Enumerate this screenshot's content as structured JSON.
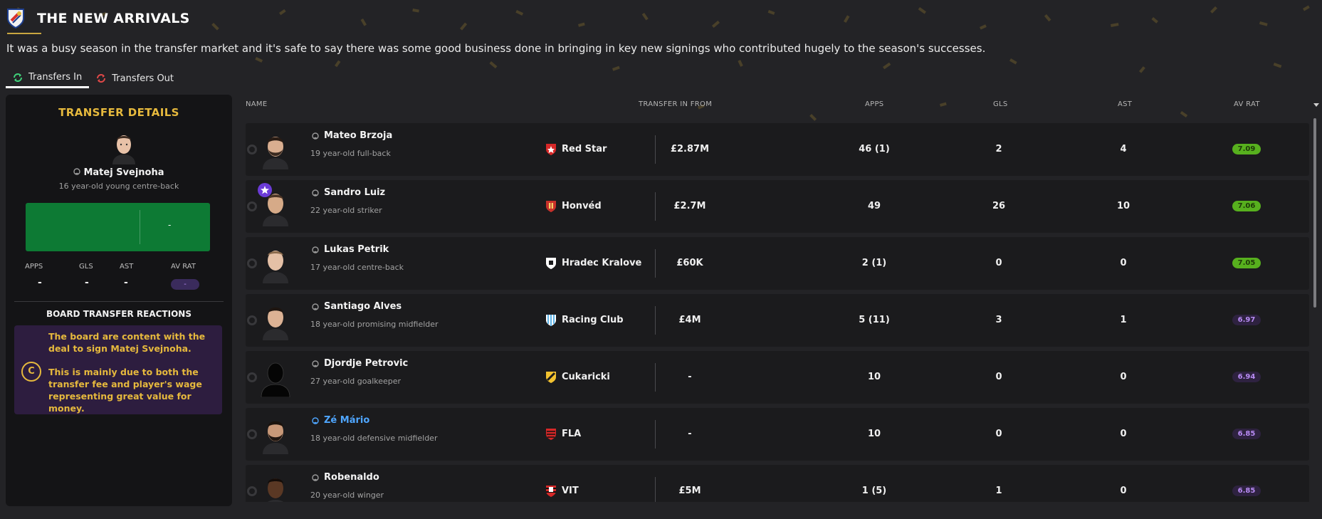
{
  "header": {
    "title": "THE NEW ARRIVALS",
    "subtitle": "It was a busy season in the transfer market and it's safe to say there was some good business done in bringing in key new signings who contributed hugely to the season's successes."
  },
  "tabs": [
    {
      "label": "Transfers In",
      "active": true
    },
    {
      "label": "Transfers Out",
      "active": false
    }
  ],
  "details": {
    "title": "TRANSFER DETAILS",
    "player_name": "Matej Svejnoha",
    "player_desc": "16 year-old young centre-back",
    "fee_value": "-",
    "stat_labels": {
      "apps": "APPS",
      "gls": "GLS",
      "ast": "AST",
      "avrat": "AV RAT"
    },
    "stat_values": {
      "apps": "-",
      "gls": "-",
      "ast": "-",
      "avrat": "-"
    },
    "board_title": "BOARD TRANSFER REACTIONS",
    "board_grade": "C",
    "board_text_1": "The board are content with the deal to sign Matej Svejnoha.",
    "board_text_2": "This is mainly due to both the transfer fee and player's wage representing great value for money."
  },
  "columns": {
    "name": "NAME",
    "from": "TRANSFER IN FROM",
    "apps": "APPS",
    "gls": "GLS",
    "ast": "AST",
    "avrat": "AV RAT"
  },
  "colors": {
    "accent_gold": "#e6b93d",
    "rating_green": "#57b01e",
    "rating_purple": "#b98cf5",
    "fee_box": "#0d7a34"
  },
  "rows": [
    {
      "name": "Mateo Brzoja",
      "desc": "19 year-old full-back",
      "club": "Red Star",
      "club_badge": "red-star-badge",
      "fee": "£2.87M",
      "apps": "46 (1)",
      "gls": "2",
      "ast": "4",
      "rating": "7.09",
      "rating_tier": "green",
      "star": false,
      "link": false,
      "face": "bearded-face"
    },
    {
      "name": "Sandro Luiz",
      "desc": "22 year-old striker",
      "club": "Honvéd",
      "club_badge": "honved-badge",
      "fee": "£2.7M",
      "apps": "49",
      "gls": "26",
      "ast": "10",
      "rating": "7.06",
      "rating_tier": "green",
      "star": true,
      "link": false,
      "face": "short-hair-face"
    },
    {
      "name": "Lukas Petrik",
      "desc": "17 year-old centre-back",
      "club": "Hradec Kralove",
      "club_badge": "hradec-kralove-badge",
      "fee": "£60K",
      "apps": "2 (1)",
      "gls": "0",
      "ast": "0",
      "rating": "7.05",
      "rating_tier": "green",
      "star": false,
      "link": false,
      "face": "young-face"
    },
    {
      "name": "Santiago Alves",
      "desc": "18 year-old promising midfielder",
      "club": "Racing Club",
      "club_badge": "racing-club-badge",
      "fee": "£4M",
      "apps": "5 (11)",
      "gls": "3",
      "ast": "1",
      "rating": "6.97",
      "rating_tier": "purple",
      "star": false,
      "link": false,
      "face": "dark-hair-face"
    },
    {
      "name": "Djordje Petrovic",
      "desc": "27 year-old goalkeeper",
      "club": "Cukaricki",
      "club_badge": "cukaricki-badge",
      "fee": "-",
      "apps": "10",
      "gls": "0",
      "ast": "0",
      "rating": "6.94",
      "rating_tier": "purple",
      "star": false,
      "link": false,
      "face": "silhouette"
    },
    {
      "name": "Zé Mário",
      "desc": "18 year-old defensive midfielder",
      "club": "FLA",
      "club_badge": "flamengo-badge",
      "fee": "-",
      "apps": "10",
      "gls": "0",
      "ast": "0",
      "rating": "6.85",
      "rating_tier": "purple",
      "star": false,
      "link": true,
      "face": "bearded-face"
    },
    {
      "name": "Robenaldo",
      "desc": "20 year-old winger",
      "club": "VIT",
      "club_badge": "vitoria-badge",
      "fee": "£5M",
      "apps": "1 (5)",
      "gls": "1",
      "ast": "0",
      "rating": "6.85",
      "rating_tier": "purple",
      "star": false,
      "link": false,
      "face": "dark-skin-face"
    }
  ]
}
